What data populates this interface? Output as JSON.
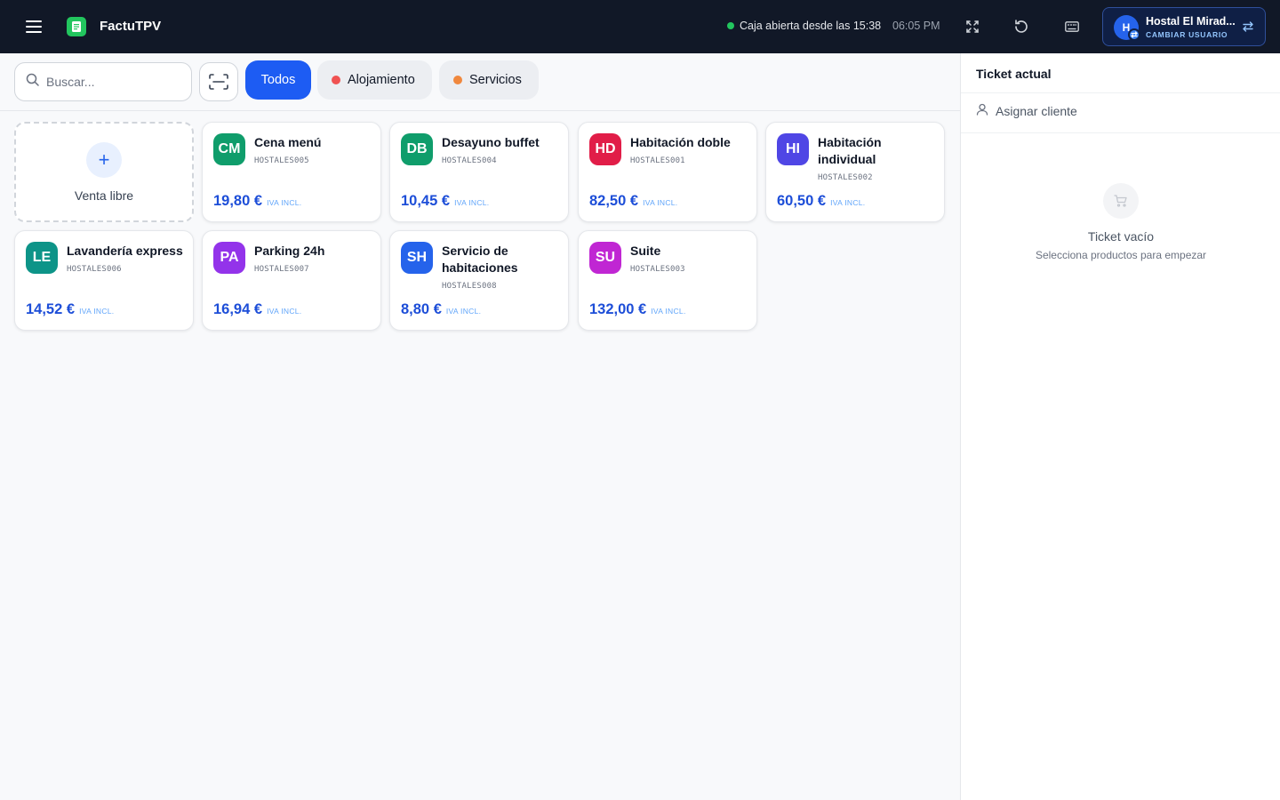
{
  "header": {
    "app_name": "FactuTPV",
    "status": "Caja abierta desde las 15:38",
    "time": "06:05 PM",
    "user": {
      "initial": "H",
      "name": "Hostal El Mirad...",
      "action": "CAMBIAR USUARIO"
    }
  },
  "toolbar": {
    "search_placeholder": "Buscar...",
    "categories": [
      {
        "label": "Todos",
        "active": true
      },
      {
        "label": "Alojamiento",
        "dot_color": "#f05252"
      },
      {
        "label": "Servicios",
        "dot_color": "#f0883e"
      }
    ]
  },
  "free_sale_label": "Venta libre",
  "products": [
    {
      "initials": "CM",
      "name": "Cena menú",
      "code": "HOSTALES005",
      "price": "19,80 €",
      "tax": "IVA INCL.",
      "color": "#0f9d6b"
    },
    {
      "initials": "DB",
      "name": "Desayuno buffet",
      "code": "HOSTALES004",
      "price": "10,45 €",
      "tax": "IVA INCL.",
      "color": "#0f9d6b"
    },
    {
      "initials": "HD",
      "name": "Habitación doble",
      "code": "HOSTALES001",
      "price": "82,50 €",
      "tax": "IVA INCL.",
      "color": "#e11d48"
    },
    {
      "initials": "HI",
      "name": "Habitación individual",
      "code": "HOSTALES002",
      "price": "60,50 €",
      "tax": "IVA INCL.",
      "color": "#4f46e5"
    },
    {
      "initials": "LE",
      "name": "Lavandería express",
      "code": "HOSTALES006",
      "price": "14,52 €",
      "tax": "IVA INCL.",
      "color": "#0d9488"
    },
    {
      "initials": "PA",
      "name": "Parking 24h",
      "code": "HOSTALES007",
      "price": "16,94 €",
      "tax": "IVA INCL.",
      "color": "#9333ea"
    },
    {
      "initials": "SH",
      "name": "Servicio de habitaciones",
      "code": "HOSTALES008",
      "price": "8,80 €",
      "tax": "IVA INCL.",
      "color": "#2563eb"
    },
    {
      "initials": "SU",
      "name": "Suite",
      "code": "HOSTALES003",
      "price": "132,00 €",
      "tax": "IVA INCL.",
      "color": "#c026d3"
    }
  ],
  "ticket": {
    "title": "Ticket actual",
    "assign_client": "Asignar cliente",
    "empty_title": "Ticket vacío",
    "empty_subtitle": "Selecciona productos para empezar"
  }
}
